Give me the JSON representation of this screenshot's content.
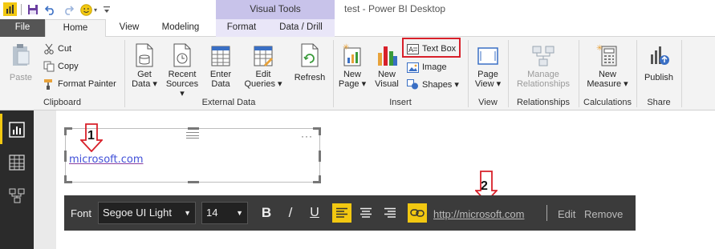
{
  "window": {
    "title": "test - Power BI Desktop",
    "contextual_tab_header": "Visual Tools"
  },
  "tabs": [
    {
      "label": "File"
    },
    {
      "label": "Home"
    },
    {
      "label": "View"
    },
    {
      "label": "Modeling"
    },
    {
      "label": "Format"
    },
    {
      "label": "Data / Drill"
    }
  ],
  "ribbon": {
    "clipboard": {
      "label": "Clipboard",
      "paste": "Paste",
      "cut": "Cut",
      "copy": "Copy",
      "format_painter": "Format Painter"
    },
    "external_data": {
      "label": "External Data",
      "get_data": [
        "Get",
        "Data ▾"
      ],
      "recent_sources": [
        "Recent",
        "Sources ▾"
      ],
      "enter_data": [
        "Enter",
        "Data"
      ],
      "edit_queries": [
        "Edit",
        "Queries ▾"
      ],
      "refresh": "Refresh"
    },
    "insert": {
      "label": "Insert",
      "new_page": [
        "New",
        "Page ▾"
      ],
      "new_visual": [
        "New",
        "Visual"
      ],
      "text_box": "Text Box",
      "image": "Image",
      "shapes": "Shapes ▾"
    },
    "view": {
      "label": "View",
      "page_view": [
        "Page",
        "View ▾"
      ]
    },
    "relationships": {
      "label": "Relationships",
      "manage": [
        "Manage",
        "Relationships"
      ]
    },
    "calculations": {
      "label": "Calculations",
      "new_measure": [
        "New",
        "Measure ▾"
      ]
    },
    "share": {
      "label": "Share",
      "publish": "Publish"
    }
  },
  "canvas": {
    "textbox_link": "microsoft.com",
    "more_options": "···",
    "annotation_1": "1",
    "annotation_2": "2"
  },
  "format_toolbar": {
    "font_label": "Font",
    "font_family": "Segoe UI Light",
    "font_size": "14",
    "bold": "B",
    "italic": "/",
    "underline": "U",
    "url": "http://microsoft.com",
    "edit": "Edit",
    "remove": "Remove"
  },
  "colors": {
    "accent": "#f2c811",
    "contextual_tab": "#c8c3ea",
    "highlight": "#d8202a",
    "toolbar_bg": "#3b3b3b"
  }
}
